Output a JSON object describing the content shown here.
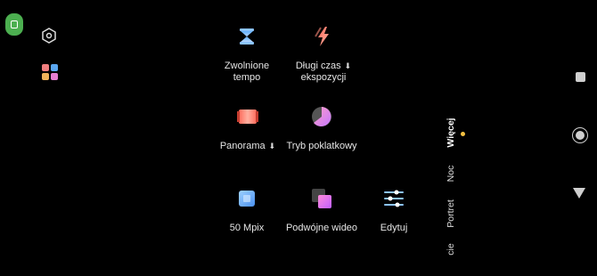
{
  "modes": [
    {
      "id": "slowmo",
      "label": "Zwolnione tempo",
      "icon": "hourglass-icon"
    },
    {
      "id": "longexp",
      "label": "Długi czas ekspozycji",
      "icon": "lightning-icon",
      "download": true
    },
    {
      "id": "panorama",
      "label": "Panorama",
      "icon": "panorama-icon",
      "download": true
    },
    {
      "id": "timelapse",
      "label": "Tryb poklatkowy",
      "icon": "timelapse-icon"
    },
    {
      "id": "50mp",
      "label": "50 Mpix",
      "icon": "high-resolution-icon"
    },
    {
      "id": "dualvideo",
      "label": "Podwójne wideo",
      "icon": "dual-video-icon"
    },
    {
      "id": "edit",
      "label": "Edytuj",
      "icon": "sliders-icon"
    }
  ],
  "labels": {
    "slowmo_line1": "Zwolnione",
    "slowmo_line2": "tempo",
    "longexp_line1": "Długi czas",
    "longexp_line2": "ekspozycji",
    "panorama": "Panorama",
    "timelapse": "Tryb poklatkowy",
    "mp50": "50 Mpix",
    "dualvideo": "Podwójne wideo",
    "edit": "Edytuj"
  },
  "mode_tabs": [
    {
      "label": "Więcej",
      "active": true
    },
    {
      "label": "Noc",
      "active": false
    },
    {
      "label": "Portret",
      "active": false
    },
    {
      "label": "cie",
      "active": false
    }
  ],
  "colors": {
    "accent_dot": "#f5c242",
    "badge": "#4caf50"
  }
}
